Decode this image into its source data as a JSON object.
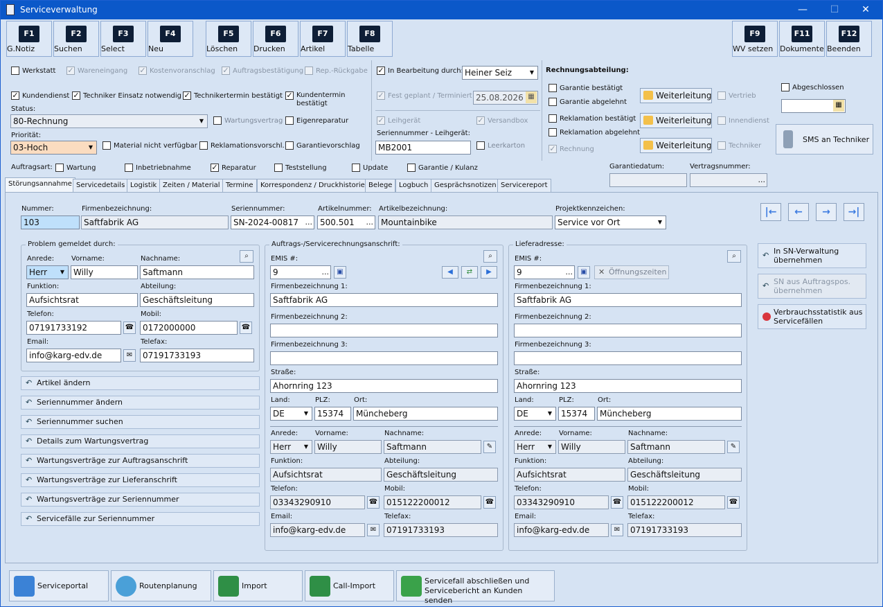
{
  "window": {
    "title": "Serviceverwaltung",
    "min": "—",
    "max": "☐",
    "close": "✕"
  },
  "fkeys": [
    {
      "key": "F1",
      "label": "G.Notiz"
    },
    {
      "key": "F2",
      "label": "Suchen"
    },
    {
      "key": "F3",
      "label": "Select"
    },
    {
      "key": "F4",
      "label": "Neu"
    },
    {
      "key": "F5",
      "label": "Löschen"
    },
    {
      "key": "F6",
      "label": "Drucken"
    },
    {
      "key": "F7",
      "label": "Artikel"
    },
    {
      "key": "F8",
      "label": "Tabelle"
    },
    {
      "key": "F9",
      "label": "WV setzen"
    },
    {
      "key": "F11",
      "label": "Dokumente"
    },
    {
      "key": "F12",
      "label": "Beenden"
    }
  ],
  "flags": {
    "werkstatt": "Werkstatt",
    "wareneingang": "Wareneingang",
    "kostenvoranschlag": "Kostenvoranschlag",
    "auftragsbestaetigung": "Auftragsbestätigung",
    "rep_rueckgabe": "Rep.-Rückgabe",
    "kundendienst": "Kundendienst",
    "techniker_einsatz": "Techniker Einsatz notwendig",
    "technikertermin": "Technikertermin bestätigt",
    "kundentermin": "Kundentermin bestätigt",
    "wartungsvertrag": "Wartungsvertrag",
    "eigenreparatur": "Eigenreparatur",
    "material": "Material nicht verfügbar",
    "reklamationsvorschl": "Reklamationsvorschl.",
    "garantievorschlag": "Garantievorschlag"
  },
  "status": {
    "label": "Status:",
    "value": "80-Rechnung"
  },
  "prioritaet": {
    "label": "Priorität:",
    "value": "03-Hoch"
  },
  "bearbeitung": {
    "label": "In Bearbeitung durch:",
    "value": "Heiner Seiz",
    "fest_geplant": "Fest geplant / Terminiert",
    "date": "25.08.2026"
  },
  "leihgeraet": {
    "leihgeraet": "Leihgerät",
    "versandbox": "Versandbox",
    "sn_label": "Seriennummer - Leihgerät:",
    "sn_value": "MB2001",
    "leerkarton": "Leerkarton"
  },
  "rechnung": {
    "title": "Rechnungsabteilung:",
    "garantie_best": "Garantie bestätigt",
    "garantie_abg": "Garantie abgelehnt",
    "reklamation_best": "Reklamation bestätigt",
    "reklamation_abg": "Reklamation abgelehnt",
    "rechnung": "Rechnung",
    "weiterleitung": "Weiterleitung",
    "vertrieb": "Vertrieb",
    "innendienst": "Innendienst",
    "techniker": "Techniker",
    "abgeschlossen": "Abgeschlossen",
    "sms": "SMS an Techniker"
  },
  "auftragsart": {
    "label": "Auftragsart:",
    "wartung": "Wartung",
    "inbetriebnahme": "Inbetriebnahme",
    "reparatur": "Reparatur",
    "teststellung": "Teststellung",
    "update": "Update",
    "garantie": "Garantie / Kulanz",
    "garantiedatum": "Garantiedatum:",
    "vertragsnummer": "Vertragsnummer:",
    "dots": "..."
  },
  "tabs": [
    "Störungsannahme",
    "Servicedetails",
    "Logistik",
    "Zeiten / Material",
    "Termine",
    "Korrespondenz / Druckhistorie",
    "Belege",
    "Logbuch",
    "Gesprächsnotizen",
    "Servicereport"
  ],
  "head": {
    "nummer_l": "Nummer:",
    "nummer": "103",
    "firma_l": "Firmenbezeichnung:",
    "firma": "Saftfabrik AG",
    "sn_l": "Seriennummer:",
    "sn": "SN-2024-00817",
    "art_l": "Artikelnummer:",
    "art": "500.501",
    "artbez_l": "Artikelbezeichnung:",
    "artbez": "Mountainbike",
    "proj_l": "Projektkennzeichen:",
    "proj": "Service vor Ort"
  },
  "nav": [
    "|←",
    "←",
    "→",
    "→|"
  ],
  "problem": {
    "title": "Problem gemeldet durch:",
    "anrede_l": "Anrede:",
    "anrede": "Herr",
    "vorname_l": "Vorname:",
    "vorname": "Willy",
    "nachname_l": "Nachname:",
    "nachname": "Saftmann",
    "funktion_l": "Funktion:",
    "funktion": "Aufsichtsrat",
    "abteilung_l": "Abteilung:",
    "abteilung": "Geschäftsleitung",
    "telefon_l": "Telefon:",
    "telefon": "07191733192",
    "mobil_l": "Mobil:",
    "mobil": "0172000000",
    "email_l": "Email:",
    "email": "info@karg-edv.de",
    "telefax_l": "Telefax:",
    "telefax": "07191733193"
  },
  "actions": [
    "Artikel ändern",
    "Seriennummer ändern",
    "Seriennummer suchen",
    "Details zum Wartungsvertrag",
    "Wartungsverträge zur Auftragsanschrift",
    "Wartungsverträge zur Lieferanschrift",
    "Wartungsverträge zur Seriennummer",
    "Servicefälle zur Seriennummer"
  ],
  "auftrag": {
    "title": "Auftrags-/Servicerechnungsanschrift:",
    "emis_l": "EMIS #:",
    "emis": "9",
    "fb1_l": "Firmenbezeichnung 1:",
    "fb1": "Saftfabrik AG",
    "fb2_l": "Firmenbezeichnung 2:",
    "fb3_l": "Firmenbezeichnung 3:",
    "strasse_l": "Straße:",
    "strasse": "Ahornring 123",
    "land_l": "Land:",
    "land": "DE",
    "plz_l": "PLZ:",
    "plz": "15374",
    "ort_l": "Ort:",
    "ort": "Müncheberg",
    "anrede": "Herr",
    "vorname": "Willy",
    "nachname": "Saftmann",
    "funktion": "Aufsichtsrat",
    "abteilung": "Geschäftsleitung",
    "telefon": "03343290910",
    "mobil": "015122200012",
    "email": "info@karg-edv.de",
    "telefax": "07191733193"
  },
  "liefer": {
    "title": "Lieferadresse:",
    "oeffnung": "Öffnungszeiten"
  },
  "right": {
    "sn_uebernehmen": "In SN-Verwaltung übernehmen",
    "sn_aus": "SN aus Auftragspos. übernehmen",
    "verbrauch": "Verbrauchsstatistik aus Servicefällen"
  },
  "bottom": [
    "Serviceportal",
    "Routenplanung",
    "Import",
    "Call-Import",
    "Servicefall abschließen und Servicebericht an Kunden senden"
  ]
}
